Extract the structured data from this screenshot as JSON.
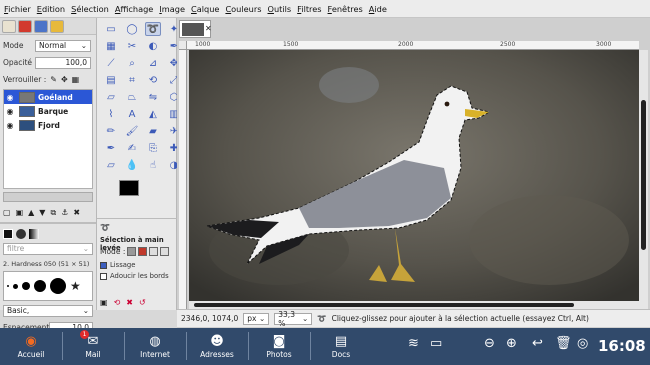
{
  "menu": [
    "Fichier",
    "Edition",
    "Sélection",
    "Affichage",
    "Image",
    "Calque",
    "Couleurs",
    "Outils",
    "Filtres",
    "Fenêtres",
    "Aide"
  ],
  "layers_panel": {
    "mode_label": "Mode",
    "mode_value": "Normal",
    "opacity_label": "Opacité",
    "opacity_value": "100,0",
    "lock_label": "Verrouiller :",
    "layers": [
      {
        "name": "Goéland",
        "selected": true
      },
      {
        "name": "Barque",
        "selected": false
      },
      {
        "name": "Fjord",
        "selected": false
      }
    ]
  },
  "brushes_panel": {
    "filter_placeholder": "filtre",
    "current_brush": "2. Hardness 050 (51 × 51)",
    "preset": "Basic,",
    "spacing_label": "Espacement",
    "spacing_value": "10,0"
  },
  "tool_options": {
    "title": "Sélection à main levée",
    "mode_label": "Mode :",
    "antialias_label": "Lissage",
    "feather_label": "Adoucir les bords"
  },
  "status": {
    "coords": "2346,0, 1074,0",
    "unit": "px",
    "zoom": "33,3 %",
    "message": "Cliquez-glissez pour ajouter à la sélection actuelle (essayez Ctrl, Alt)"
  },
  "taskbar": {
    "launchers": [
      {
        "label": "Accueil",
        "icon": "home-icon"
      },
      {
        "label": "Mail",
        "icon": "mail-icon",
        "badge": "1"
      },
      {
        "label": "Internet",
        "icon": "globe-icon"
      },
      {
        "label": "Adresses",
        "icon": "contacts-icon"
      },
      {
        "label": "Photos",
        "icon": "camera-icon"
      },
      {
        "label": "Docs",
        "icon": "documents-icon"
      }
    ],
    "clock": "16:08"
  },
  "ruler_ticks": [
    "1000",
    "1500",
    "2000",
    "2500",
    "3000"
  ]
}
